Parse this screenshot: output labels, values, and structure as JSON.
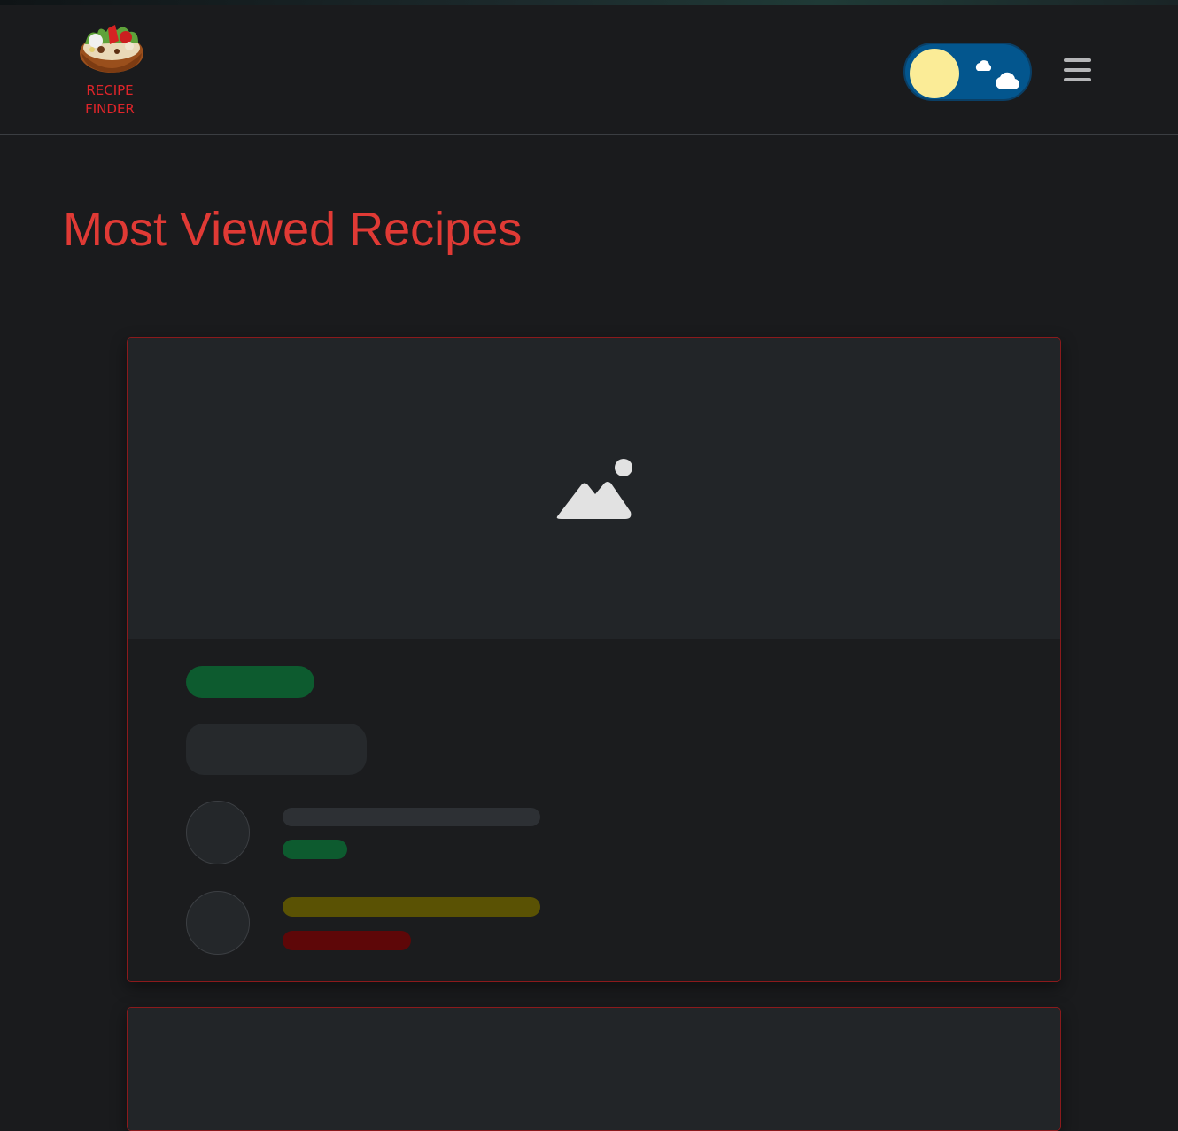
{
  "brand": {
    "line1": "RECIPE",
    "line2": "FINDER",
    "logo_icon": "salad-bowl-icon",
    "color": "#e0252a"
  },
  "header": {
    "theme_toggle": {
      "icon": "sun-cloud-toggle-icon",
      "state": "day",
      "knob_color": "#fbec97",
      "track_color": "#03568e"
    },
    "menu_icon": "hamburger-menu-icon"
  },
  "main": {
    "title": "Most Viewed Recipes",
    "title_color": "#e03a35",
    "cards": [
      {
        "state": "loading-skeleton",
        "image_icon": "image-placeholder-icon",
        "badge_color": "#0d5b2f",
        "rows": [
          {
            "line_colors": [
              "#2d3034",
              "#0d5b2f"
            ]
          },
          {
            "line_colors": [
              "#5a5204",
              "#5e0708"
            ]
          }
        ]
      },
      {
        "state": "loading-skeleton"
      }
    ]
  },
  "colors": {
    "background": "#1a1b1d",
    "card_border": "#8b1a1c",
    "image_divider": "#c58a1f"
  }
}
